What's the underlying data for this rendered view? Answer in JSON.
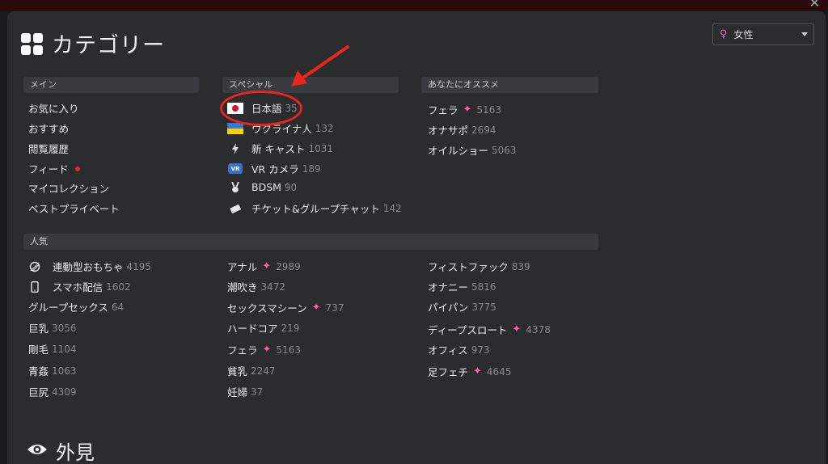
{
  "header": {
    "title": "カテゴリー"
  },
  "gender_select": {
    "value": "女性"
  },
  "main_section": {
    "label": "メイン",
    "items": [
      {
        "label": "お気に入り"
      },
      {
        "label": "おすすめ"
      },
      {
        "label": "閲覧履歴"
      },
      {
        "label": "フィード"
      },
      {
        "label": "マイコレクション"
      },
      {
        "label": "ベストプライベート"
      }
    ]
  },
  "special_section": {
    "label": "スペシャル",
    "items": [
      {
        "label": "日本語",
        "count": "35",
        "icon": "japan-flag-icon"
      },
      {
        "label": "ウクライナ人",
        "count": "132",
        "icon": "ukraine-flag-icon"
      },
      {
        "label": "新 キャスト",
        "count": "1031",
        "icon": "lightning-icon"
      },
      {
        "label": "VR カメラ",
        "count": "189",
        "icon": "vr-icon",
        "icon_text": "VR"
      },
      {
        "label": "BDSM",
        "count": "90",
        "icon": "bunny-icon"
      },
      {
        "label": "チケット&グループチャット",
        "count": "142",
        "icon": "ticket-icon"
      }
    ]
  },
  "recommended_section": {
    "label": "あなたにオススメ",
    "items": [
      {
        "label": "フェラ",
        "count": "5163"
      },
      {
        "label": "オナサポ",
        "count": "2694"
      },
      {
        "label": "オイルショー",
        "count": "5063"
      }
    ]
  },
  "popular_section": {
    "label": "人気",
    "col1": [
      {
        "label": "連動型おもちゃ",
        "count": "4195"
      },
      {
        "label": "スマホ配信",
        "count": "1602"
      },
      {
        "label": "グループセックス",
        "count": "64"
      },
      {
        "label": "巨乳",
        "count": "3056"
      },
      {
        "label": "剛毛",
        "count": "1104"
      },
      {
        "label": "青姦",
        "count": "1063"
      },
      {
        "label": "巨尻",
        "count": "4309"
      }
    ],
    "col2": [
      {
        "label": "アナル",
        "count": "2989"
      },
      {
        "label": "潮吹き",
        "count": "3472"
      },
      {
        "label": "セックスマシーン",
        "count": "737"
      },
      {
        "label": "ハードコア",
        "count": "219"
      },
      {
        "label": "フェラ",
        "count": "5163"
      },
      {
        "label": "貧乳",
        "count": "2247"
      },
      {
        "label": "妊婦",
        "count": "37"
      }
    ],
    "col3": [
      {
        "label": "フィストファック",
        "count": "839"
      },
      {
        "label": "オナニー",
        "count": "5816"
      },
      {
        "label": "パイパン",
        "count": "3775"
      },
      {
        "label": "ディープスロート",
        "count": "4378"
      },
      {
        "label": "オフィス",
        "count": "973"
      },
      {
        "label": "足フェチ",
        "count": "4645"
      }
    ]
  },
  "appearance": {
    "title": "外見"
  },
  "colors": {
    "background": "#2b2c2e",
    "accent_pink": "#ff5ca8",
    "annotation_red": "#e8261e"
  }
}
